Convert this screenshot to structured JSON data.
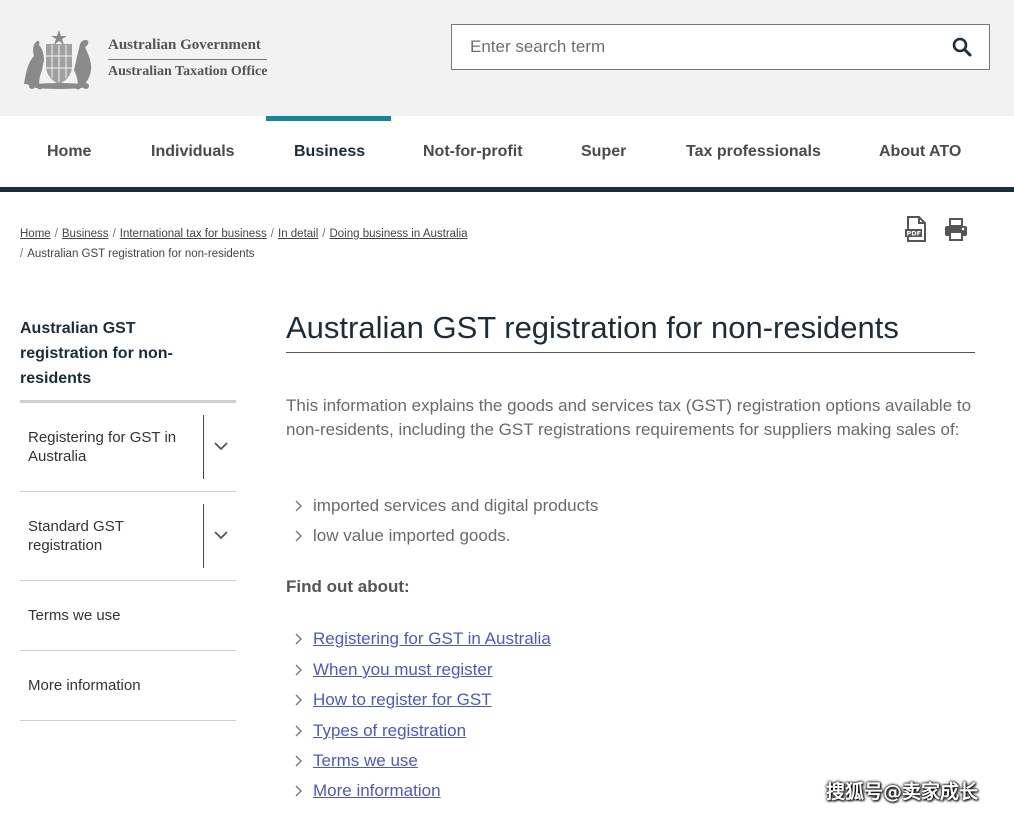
{
  "header": {
    "logo": {
      "line1": "Australian Government",
      "line2": "Australian Taxation Office"
    },
    "search": {
      "placeholder": "Enter search term",
      "icon": "search-icon"
    }
  },
  "nav": {
    "items": [
      {
        "label": "Home",
        "active": false
      },
      {
        "label": "Individuals",
        "active": false
      },
      {
        "label": "Business",
        "active": true
      },
      {
        "label": "Not-for-profit",
        "active": false
      },
      {
        "label": "Super",
        "active": false
      },
      {
        "label": "Tax professionals",
        "active": false
      },
      {
        "label": "About ATO",
        "active": false
      }
    ],
    "active_color": "#13859c",
    "rule_color": "#1c2d3a"
  },
  "breadcrumb": {
    "links": [
      "Home",
      "Business",
      "International tax for business",
      "In detail",
      "Doing business in Australia"
    ],
    "current": "Australian GST registration for non-residents",
    "separator": "/"
  },
  "tools": {
    "pdf_icon": "pdf-icon",
    "print_icon": "print-icon"
  },
  "sidebar": {
    "title": "Australian GST registration for non-residents",
    "items": [
      {
        "label": "Registering for GST in Australia",
        "expandable": true
      },
      {
        "label": "Standard GST registration",
        "expandable": true
      },
      {
        "label": "Terms we use",
        "expandable": false
      },
      {
        "label": "More information",
        "expandable": false
      }
    ]
  },
  "main": {
    "title": "Australian GST registration for non-residents",
    "intro": "This information explains the goods and services tax (GST) registration options available to non-residents, including the GST registrations requirements for suppliers making sales of:",
    "bullets": [
      "imported services and digital products",
      "low value imported goods."
    ],
    "find_heading": "Find out about:",
    "links": [
      "Registering for GST in Australia",
      "When you must register",
      "How to register for GST",
      "Types of registration",
      "Terms we use",
      "More information"
    ],
    "link_color": "#4b58c8"
  },
  "watermark": "搜狐号@卖家成长"
}
